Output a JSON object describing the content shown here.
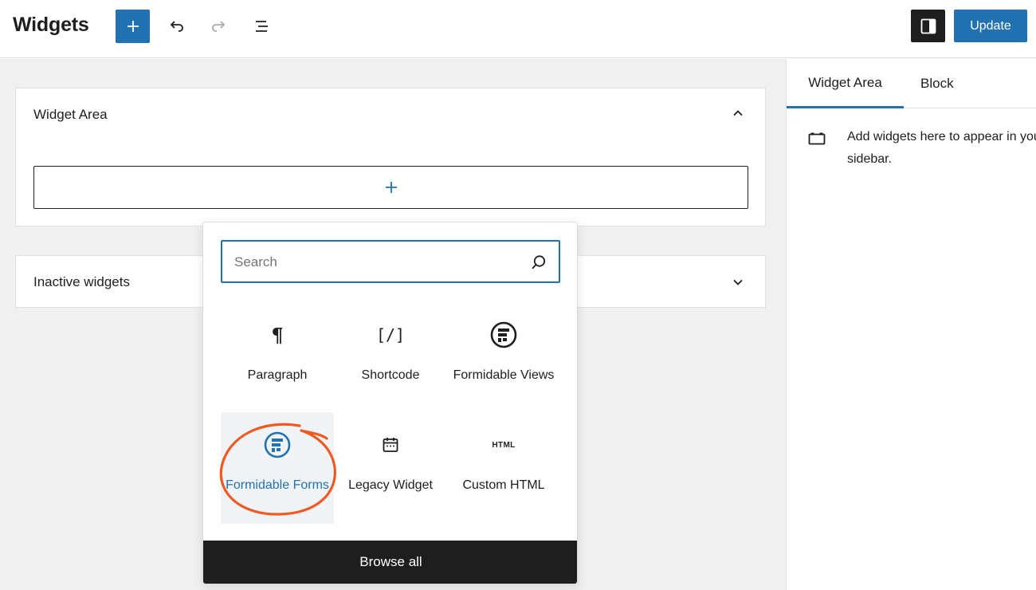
{
  "header": {
    "title": "Widgets",
    "update_label": "Update"
  },
  "colors": {
    "accent": "#2271b1",
    "dark": "#1e1e1e",
    "canvas_bg": "#f0f0f0",
    "annotation": "#f05a22"
  },
  "icons": {
    "add": "plus-icon",
    "undo": "undo-icon",
    "redo": "redo-icon",
    "list_view": "list-view-icon",
    "settings": "sidebar-toggle-icon"
  },
  "canvas": {
    "widget_area": {
      "title": "Widget Area",
      "expanded": true
    },
    "inactive": {
      "title": "Inactive widgets",
      "expanded": false
    }
  },
  "sidebar": {
    "tabs": [
      {
        "label": "Widget Area",
        "active": true
      },
      {
        "label": "Block",
        "active": false
      }
    ],
    "description": "Add widgets here to appear in your sidebar."
  },
  "inserter": {
    "search_placeholder": "Search",
    "blocks": [
      {
        "label": "Paragraph",
        "icon": "paragraph-icon"
      },
      {
        "label": "Shortcode",
        "icon": "shortcode-icon"
      },
      {
        "label": "Formidable Views",
        "icon": "formidable-icon"
      },
      {
        "label": "Formidable Forms",
        "icon": "formidable-icon",
        "highlighted": true
      },
      {
        "label": "Legacy Widget",
        "icon": "calendar-icon"
      },
      {
        "label": "Custom HTML",
        "icon": "html-icon"
      }
    ],
    "browse_all": "Browse all"
  }
}
